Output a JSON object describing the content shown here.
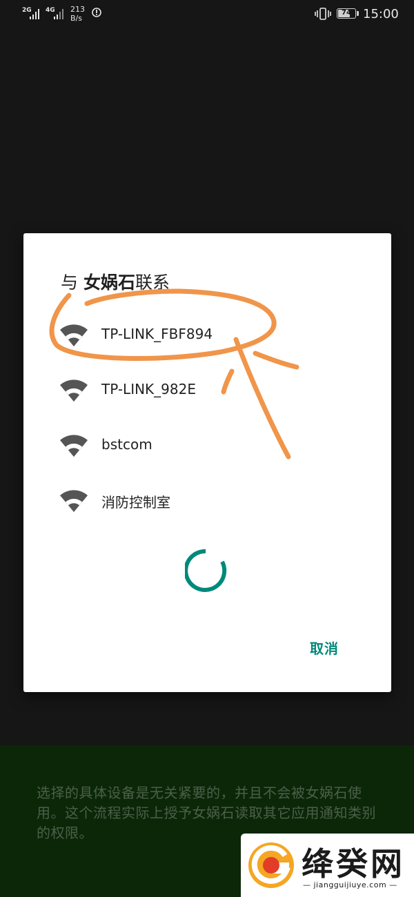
{
  "status_bar": {
    "sim1_type": "2G",
    "sim2_type": "4G",
    "net_speed_value": "213",
    "net_speed_unit": "B/s",
    "battery_level": "74",
    "battery_fraction": 0.74,
    "time": "15:00"
  },
  "dialog": {
    "title_prefix": "与 ",
    "title_app": "女娲石",
    "title_suffix": "联系",
    "devices": [
      {
        "name": "TP-LINK_FBF894",
        "icon": "wifi-icon"
      },
      {
        "name": "TP-LINK_982E",
        "icon": "wifi-icon"
      },
      {
        "name": "bstcom",
        "icon": "wifi-icon"
      },
      {
        "name": "消防控制室",
        "icon": "wifi-icon"
      }
    ],
    "cancel_label": "取消",
    "accent_color": "#00897b"
  },
  "info_text": "选择的具体设备是无关紧要的，并且不会被女娲石使用。这个流程实际上授予女娲石读取其它应用通知类别的权限。",
  "watermark": {
    "title": "绛癸网",
    "url": "— jiangguijiuye.com —"
  },
  "colors": {
    "background": "#161616",
    "annotation": "#f0954a",
    "info_panel": "#0b2708"
  }
}
